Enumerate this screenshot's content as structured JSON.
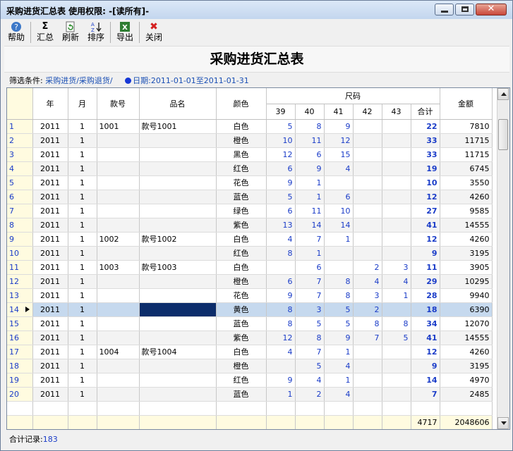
{
  "window": {
    "title": "采购进货汇总表  使用权限: -[读所有]-"
  },
  "toolbar": {
    "help": "帮助",
    "summary": "汇总",
    "refresh": "刷新",
    "sort": "排序",
    "export": "导出",
    "close": "关闭"
  },
  "report": {
    "title": "采购进货汇总表"
  },
  "filter": {
    "label": "筛选条件:",
    "value": "采购进货/采购退货/",
    "date_label": "日期:",
    "date_value": "2011-01-01至2011-01-31"
  },
  "columns": {
    "year": "年",
    "month": "月",
    "style_no": "款号",
    "name": "品名",
    "color": "颜色",
    "size_group": "尺码",
    "sizes": [
      "39",
      "40",
      "41",
      "42",
      "43"
    ],
    "subtotal": "合计",
    "amount": "金额"
  },
  "rows": [
    {
      "n": "1",
      "year": "2011",
      "month": "1",
      "style": "1001",
      "name": "款号1001",
      "color": "白色",
      "s39": "5",
      "s40": "8",
      "s41": "9",
      "s42": "",
      "s43": "",
      "total": "22",
      "amount": "7810"
    },
    {
      "n": "2",
      "year": "2011",
      "month": "1",
      "style": "",
      "name": "",
      "color": "橙色",
      "s39": "10",
      "s40": "11",
      "s41": "12",
      "s42": "",
      "s43": "",
      "total": "33",
      "amount": "11715"
    },
    {
      "n": "3",
      "year": "2011",
      "month": "1",
      "style": "",
      "name": "",
      "color": "黑色",
      "s39": "12",
      "s40": "6",
      "s41": "15",
      "s42": "",
      "s43": "",
      "total": "33",
      "amount": "11715"
    },
    {
      "n": "4",
      "year": "2011",
      "month": "1",
      "style": "",
      "name": "",
      "color": "红色",
      "s39": "6",
      "s40": "9",
      "s41": "4",
      "s42": "",
      "s43": "",
      "total": "19",
      "amount": "6745"
    },
    {
      "n": "5",
      "year": "2011",
      "month": "1",
      "style": "",
      "name": "",
      "color": "花色",
      "s39": "9",
      "s40": "1",
      "s41": "",
      "s42": "",
      "s43": "",
      "total": "10",
      "amount": "3550"
    },
    {
      "n": "6",
      "year": "2011",
      "month": "1",
      "style": "",
      "name": "",
      "color": "蓝色",
      "s39": "5",
      "s40": "1",
      "s41": "6",
      "s42": "",
      "s43": "",
      "total": "12",
      "amount": "4260"
    },
    {
      "n": "7",
      "year": "2011",
      "month": "1",
      "style": "",
      "name": "",
      "color": "绿色",
      "s39": "6",
      "s40": "11",
      "s41": "10",
      "s42": "",
      "s43": "",
      "total": "27",
      "amount": "9585"
    },
    {
      "n": "8",
      "year": "2011",
      "month": "1",
      "style": "",
      "name": "",
      "color": "紫色",
      "s39": "13",
      "s40": "14",
      "s41": "14",
      "s42": "",
      "s43": "",
      "total": "41",
      "amount": "14555"
    },
    {
      "n": "9",
      "year": "2011",
      "month": "1",
      "style": "1002",
      "name": "款号1002",
      "color": "白色",
      "s39": "4",
      "s40": "7",
      "s41": "1",
      "s42": "",
      "s43": "",
      "total": "12",
      "amount": "4260"
    },
    {
      "n": "10",
      "year": "2011",
      "month": "1",
      "style": "",
      "name": "",
      "color": "红色",
      "s39": "8",
      "s40": "1",
      "s41": "",
      "s42": "",
      "s43": "",
      "total": "9",
      "amount": "3195"
    },
    {
      "n": "11",
      "year": "2011",
      "month": "1",
      "style": "1003",
      "name": "款号1003",
      "color": "白色",
      "s39": "",
      "s40": "6",
      "s41": "",
      "s42": "2",
      "s43": "3",
      "total": "11",
      "amount": "3905"
    },
    {
      "n": "12",
      "year": "2011",
      "month": "1",
      "style": "",
      "name": "",
      "color": "橙色",
      "s39": "6",
      "s40": "7",
      "s41": "8",
      "s42": "4",
      "s43": "4",
      "total": "29",
      "amount": "10295"
    },
    {
      "n": "13",
      "year": "2011",
      "month": "1",
      "style": "",
      "name": "",
      "color": "花色",
      "s39": "9",
      "s40": "7",
      "s41": "8",
      "s42": "3",
      "s43": "1",
      "total": "28",
      "amount": "9940"
    },
    {
      "n": "14",
      "year": "2011",
      "month": "1",
      "style": "",
      "name": "",
      "color": "黄色",
      "s39": "8",
      "s40": "3",
      "s41": "5",
      "s42": "2",
      "s43": "",
      "total": "18",
      "amount": "6390"
    },
    {
      "n": "15",
      "year": "2011",
      "month": "1",
      "style": "",
      "name": "",
      "color": "蓝色",
      "s39": "8",
      "s40": "5",
      "s41": "5",
      "s42": "8",
      "s43": "8",
      "total": "34",
      "amount": "12070"
    },
    {
      "n": "16",
      "year": "2011",
      "month": "1",
      "style": "",
      "name": "",
      "color": "紫色",
      "s39": "12",
      "s40": "8",
      "s41": "9",
      "s42": "7",
      "s43": "5",
      "total": "41",
      "amount": "14555"
    },
    {
      "n": "17",
      "year": "2011",
      "month": "1",
      "style": "1004",
      "name": "款号1004",
      "color": "白色",
      "s39": "4",
      "s40": "7",
      "s41": "1",
      "s42": "",
      "s43": "",
      "total": "12",
      "amount": "4260"
    },
    {
      "n": "18",
      "year": "2011",
      "month": "1",
      "style": "",
      "name": "",
      "color": "橙色",
      "s39": "",
      "s40": "5",
      "s41": "4",
      "s42": "",
      "s43": "",
      "total": "9",
      "amount": "3195"
    },
    {
      "n": "19",
      "year": "2011",
      "month": "1",
      "style": "",
      "name": "",
      "color": "红色",
      "s39": "9",
      "s40": "4",
      "s41": "1",
      "s42": "",
      "s43": "",
      "total": "14",
      "amount": "4970"
    },
    {
      "n": "20",
      "year": "2011",
      "month": "1",
      "style": "",
      "name": "",
      "color": "蓝色",
      "s39": "1",
      "s40": "2",
      "s41": "4",
      "s42": "",
      "s43": "",
      "total": "7",
      "amount": "2485"
    }
  ],
  "selected_row": "14",
  "footer": {
    "total_qty": "4717",
    "total_amount": "2048606"
  },
  "status": {
    "label": "合计记录:",
    "count": "183"
  },
  "colors": {
    "accent": "#1a3cc8",
    "selection": "#c6d9ee",
    "cursor_cell": "#0c2d6b",
    "row_header": "#fffbe0"
  }
}
